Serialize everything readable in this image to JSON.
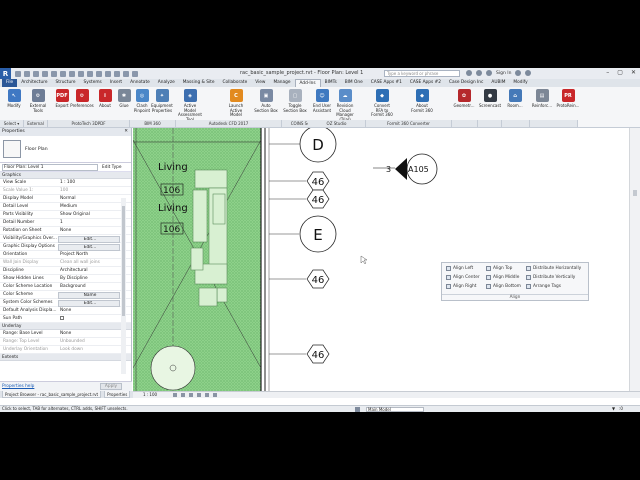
{
  "app": {
    "logo": "R",
    "title": "rac_basic_sample_project.rvt - Floor Plan: Level 1",
    "search_placeholder": "Type a keyword or phrase",
    "sign_in": "Sign In",
    "window_controls": [
      "–",
      "▢",
      "✕"
    ]
  },
  "tabs": [
    "File",
    "Architecture",
    "Structure",
    "Systems",
    "Insert",
    "Annotate",
    "Analyze",
    "Massing & Site",
    "Collaborate",
    "View",
    "Manage",
    "Add-Ins",
    "BIMTs",
    "BIM One",
    "CASE Apps #1",
    "CASE Apps #2",
    "Case Design Inc",
    "AUBIM",
    "Modify"
  ],
  "active_tab_index": 11,
  "ribbon": {
    "buttons": [
      {
        "label": "Modify",
        "icon": "cursor-arrow-icon",
        "color": "#3f78c3",
        "glyph": "↖"
      },
      {
        "label": "External Tools",
        "icon": "external-tools-icon",
        "color": "#6e7d96",
        "glyph": "⚙"
      },
      {
        "label": "Export",
        "icon": "pdf-export-icon",
        "color": "#c9272a",
        "glyph": "PDF"
      },
      {
        "label": "Preferences",
        "icon": "preferences-icon",
        "color": "#c9272a",
        "glyph": "⚙"
      },
      {
        "label": "About",
        "icon": "about-icon",
        "color": "#c9272a",
        "glyph": "i"
      },
      {
        "label": "Glue",
        "icon": "glue-icon",
        "color": "#7a8798",
        "glyph": "✱"
      },
      {
        "label": "Clash Pinpoint",
        "icon": "clash-pinpoint-icon",
        "color": "#4b87c8",
        "glyph": "◎"
      },
      {
        "label": "Equipment Properties",
        "icon": "equipment-properties-icon",
        "color": "#4e7fb6",
        "glyph": "✦"
      },
      {
        "label": "Active Model Assessment Tool",
        "icon": "assessment-tool-icon",
        "color": "#3d6fb0",
        "glyph": "◈"
      },
      {
        "label": "Launch Active Model",
        "icon": "cfd-launch-icon",
        "color": "#e28a1f",
        "glyph": "C"
      },
      {
        "label": "Auto Section Box",
        "icon": "section-box-icon",
        "color": "#7a8aa3",
        "glyph": "▣"
      },
      {
        "label": "Toggle Section Box",
        "icon": "toggle-section-box-icon",
        "color": "#a8b1be",
        "glyph": "▢"
      },
      {
        "label": "End User Assistant",
        "icon": "user-assistant-icon",
        "color": "#3f79c0",
        "glyph": "☺"
      },
      {
        "label": "Revision Cloud Manager (Trial)",
        "icon": "revision-cloud-icon",
        "color": "#5a8dc9",
        "glyph": "☁"
      },
      {
        "label": "Convert RFA to Formit 360",
        "icon": "formit-convert-icon",
        "color": "#2e6fb5",
        "glyph": "◆"
      },
      {
        "label": "About Formit 360",
        "icon": "formit-about-icon",
        "color": "#2e6fb5",
        "glyph": "◆"
      },
      {
        "label": "Geometr...",
        "icon": "geometry-icon",
        "color": "#b5282c",
        "glyph": "✿"
      },
      {
        "label": "Screencast",
        "icon": "screencast-icon",
        "color": "#333a44",
        "glyph": "●"
      },
      {
        "label": "Room...",
        "icon": "room-icon",
        "color": "#4579b8",
        "glyph": "⌂"
      },
      {
        "label": "Reinforc...",
        "icon": "reinforcement-icon",
        "color": "#7d8796",
        "glyph": "▤"
      },
      {
        "label": "ProtoRein...",
        "icon": "protorein-icon",
        "color": "#c9272a",
        "glyph": "PR"
      }
    ],
    "panels": [
      "Select ▾",
      "External",
      "ProtoTech 3DPDF",
      "BIM 360",
      "Autodesk CFD 2017",
      "COINS Section Box",
      "OZ Studio",
      "Formit 360 Converter",
      "",
      "",
      "",
      ""
    ]
  },
  "properties": {
    "title": "Properties",
    "close": "✕",
    "type_name": "Floor Plan",
    "instance": "Floor Plan: Level 1",
    "edit_type": "Edit Type",
    "groups": {
      "graphics": "Graphics",
      "underlay": "Underlay",
      "extents": "Extents"
    },
    "rows": [
      {
        "k": "View Scale",
        "v": "1 : 100"
      },
      {
        "k": "Scale Value   1:",
        "v": "100",
        "grey": true
      },
      {
        "k": "Display Model",
        "v": "Normal"
      },
      {
        "k": "Detail Level",
        "v": "Medium"
      },
      {
        "k": "Parts Visibility",
        "v": "Show Original"
      },
      {
        "k": "Detail Number",
        "v": "1"
      },
      {
        "k": "Rotation on Sheet",
        "v": "None"
      },
      {
        "k": "Visibility/Graphics Over...",
        "v": "Edit...",
        "btn": true
      },
      {
        "k": "Graphic Display Options",
        "v": "Edit...",
        "btn": true
      },
      {
        "k": "Orientation",
        "v": "Project North"
      },
      {
        "k": "Wall Join Display",
        "v": "Clean all wall joins",
        "grey": true
      },
      {
        "k": "Discipline",
        "v": "Architectural"
      },
      {
        "k": "Show Hidden Lines",
        "v": "By Discipline"
      },
      {
        "k": "Color Scheme Location",
        "v": "Background"
      },
      {
        "k": "Color Scheme",
        "v": "Name",
        "btn": true
      },
      {
        "k": "System Color Schemes",
        "v": "Edit...",
        "btn": true
      },
      {
        "k": "Default Analysis Displa...",
        "v": "None"
      },
      {
        "k": "Sun Path",
        "v": "",
        "check": true
      }
    ],
    "underlay_rows": [
      {
        "k": "Range: Base Level",
        "v": "None"
      },
      {
        "k": "Range: Top Level",
        "v": "Unbounded",
        "grey": true
      },
      {
        "k": "Underlay Orientation",
        "v": "Look down",
        "grey": true
      }
    ],
    "help_link": "Properties help",
    "apply": "Apply"
  },
  "browser_tabs": [
    "Project Browser - rac_basic_sample_project.rvt",
    "Properties"
  ],
  "drawing": {
    "room_labels": [
      "Living",
      "106",
      "Living",
      "106"
    ],
    "grid_bubbles": [
      "D",
      "E"
    ],
    "level_tags": [
      "46",
      "46",
      "46",
      "46",
      "46"
    ],
    "section_mark": {
      "number": "3",
      "sheet": "A105"
    }
  },
  "align_menu": {
    "title": "Align",
    "items": [
      "Align Left",
      "Align Top",
      "Distribute Horizontally",
      "Align Center",
      "Align Middle",
      "Distribute Vertically",
      "Align Right",
      "Align Bottom",
      "Arrange Tags"
    ]
  },
  "view_bar": {
    "scale": "1 : 100"
  },
  "status": {
    "hint": "Click to select, TAB for alternates, CTRL adds, SHIFT unselects.",
    "model": "Main Model",
    "filter_count": ":0"
  }
}
